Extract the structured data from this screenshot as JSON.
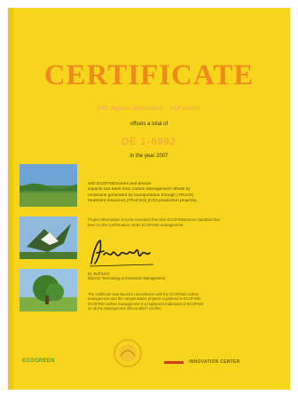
{
  "certificate": {
    "title": "CERTIFICATE",
    "subtitle": "DIS Aglaila Akwaracisi - 193 wosils",
    "offsets_line": "offsets a total of",
    "amount": "DE 1-6992",
    "year_line": "in the year 2007",
    "body_lines": [
      "with ECOFINDtonnes and annual",
      "impacts has been from carbon Management offsets by",
      "emissions generated by transportation through [TRUCK]",
      "treatment resources [TRUCKS] [CO2 production projects]."
    ],
    "confirmation_lines": [
      "Project information is to be reviewed from the ECOFINDtonnes standard has",
      "been to the confirmation under ECOFIND management."
    ],
    "signatory_lines": [
      "Dr. Rolf Erich",
      "Director Technology & Innovation Management"
    ],
    "footnote_lines": [
      "The certificate was issued in accordance with the ECOFIND carbon",
      "management and the compensation projects registered in ECOFIND.",
      "ECOFIND carbon management is a registered trademark of ECOFIND",
      "on all the Management offices which confirm."
    ],
    "logos": {
      "left": "ECOGREEN",
      "right": "INNOVATION CENTER"
    },
    "colors": {
      "paper": "#f7d51c",
      "title": "#f08a1d"
    }
  }
}
